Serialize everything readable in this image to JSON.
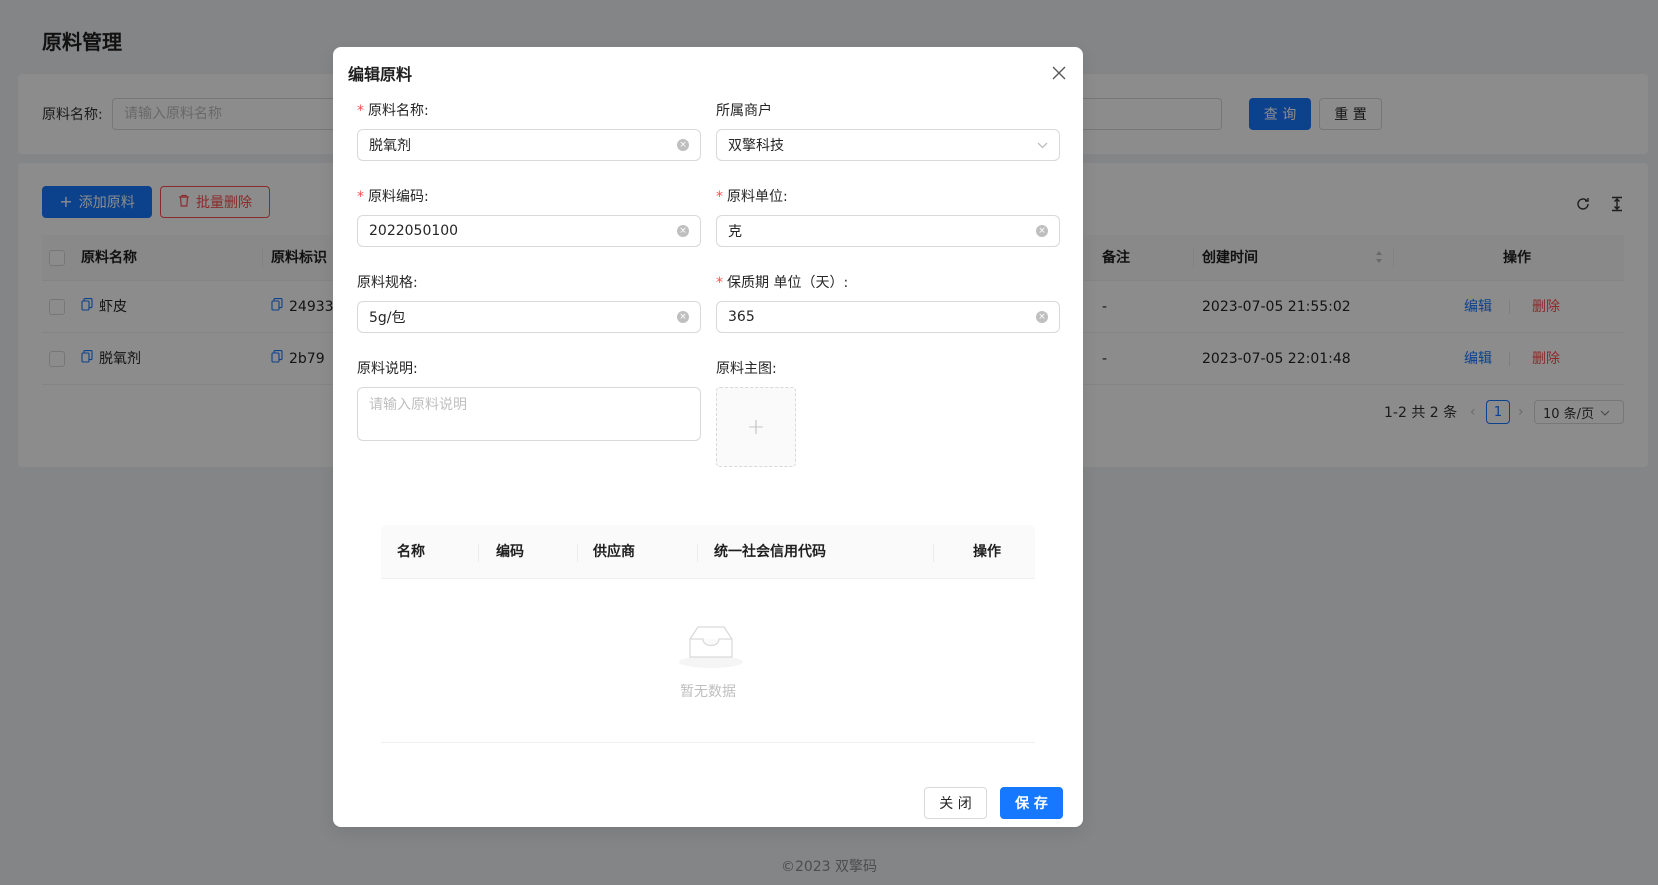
{
  "page": {
    "title": "原料管理",
    "footer": "©2023 双擎码"
  },
  "search": {
    "label": "原料名称:",
    "placeholder": "请输入原料名称",
    "query_label": "查 询",
    "reset_label": "重 置"
  },
  "toolbar": {
    "add_label": "添加原料",
    "batch_delete_label": "批量删除",
    "refresh_icon": "reload-icon",
    "density_icon": "column-height-icon"
  },
  "table": {
    "columns": {
      "name": "原料名称",
      "identifier": "原料标识",
      "remark": "备注",
      "created": "创建时间",
      "action": "操作"
    },
    "rows": [
      {
        "name": "虾皮",
        "identifier": "24933",
        "remark": "-",
        "created": "2023-07-05 21:55:02",
        "edit": "编辑",
        "delete": "删除"
      },
      {
        "name": "脱氧剂",
        "identifier": "2b79",
        "remark": "-",
        "created": "2023-07-05 22:01:48",
        "edit": "编辑",
        "delete": "删除"
      }
    ],
    "pagination": {
      "total_text": "1-2 共 2 条",
      "current_page": "1",
      "page_size": "10 条/页"
    }
  },
  "modal": {
    "title": "编辑原料",
    "fields": {
      "name_label": "原料名称:",
      "name_value": "脱氧剂",
      "merchant_label": "所属商户",
      "merchant_value": "双擎科技",
      "code_label": "原料编码:",
      "code_value": "2022050100",
      "unit_label": "原料单位:",
      "unit_value": "克",
      "spec_label": "原料规格:",
      "spec_value": "5g/包",
      "shelf_label": "保质期 单位（天）:",
      "shelf_value": "365",
      "desc_label": "原料说明:",
      "desc_placeholder": "请输入原料说明",
      "image_label": "原料主图:",
      "upload_plus": "+"
    },
    "supplier_table": {
      "columns": {
        "name": "名称",
        "code": "编码",
        "supplier": "供应商",
        "credit_code": "统一社会信用代码",
        "action": "操作"
      },
      "empty_text": "暂无数据"
    },
    "close_label": "关 闭",
    "save_label": "保 存"
  }
}
